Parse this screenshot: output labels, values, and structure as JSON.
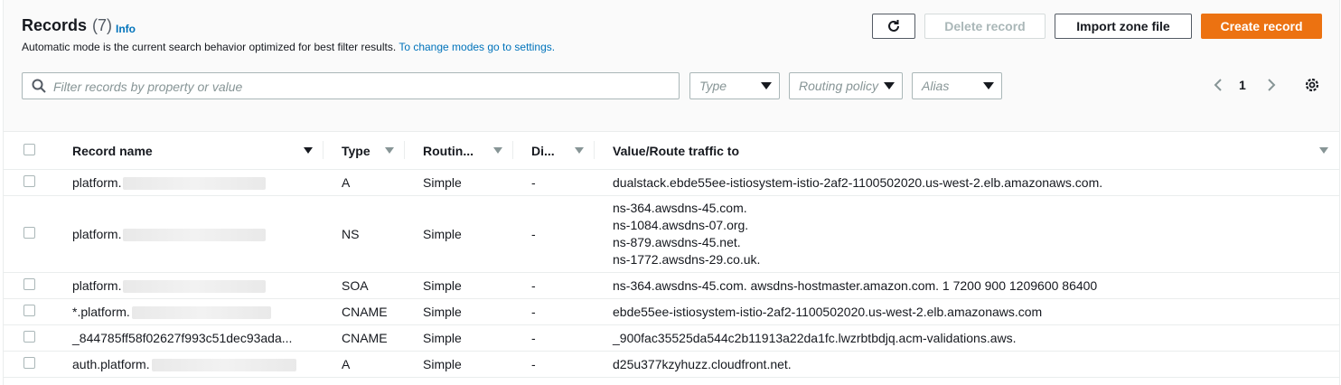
{
  "header": {
    "title": "Records",
    "count": "(7)",
    "info_link": "Info",
    "description": "Automatic mode is the current search behavior optimized for best filter results.",
    "description_link": "To change modes go to settings."
  },
  "toolbar": {
    "refresh_icon": "refresh-icon",
    "delete_label": "Delete record",
    "import_label": "Import zone file",
    "create_label": "Create record"
  },
  "filters": {
    "search_placeholder": "Filter records by property or value",
    "type_label": "Type",
    "routing_label": "Routing policy",
    "alias_label": "Alias"
  },
  "pagination": {
    "current_page": "1"
  },
  "table": {
    "columns": [
      "Record name",
      "Type",
      "Routin...",
      "Di...",
      "Value/Route traffic to"
    ],
    "rows": [
      {
        "name": "platform.",
        "type": "A",
        "routing": "Simple",
        "di": "-",
        "values": [
          "dualstack.ebde55ee-istiosystem-istio-2af2-1100502020.us-west-2.elb.amazonaws.com."
        ]
      },
      {
        "name": "platform.",
        "type": "NS",
        "routing": "Simple",
        "di": "-",
        "values": [
          "ns-364.awsdns-45.com.",
          "ns-1084.awsdns-07.org.",
          "ns-879.awsdns-45.net.",
          "ns-1772.awsdns-29.co.uk."
        ]
      },
      {
        "name": "platform.",
        "type": "SOA",
        "routing": "Simple",
        "di": "-",
        "values": [
          "ns-364.awsdns-45.com. awsdns-hostmaster.amazon.com. 1 7200 900 1209600 86400"
        ]
      },
      {
        "name": "*.platform.",
        "type": "CNAME",
        "routing": "Simple",
        "di": "-",
        "values": [
          "ebde55ee-istiosystem-istio-2af2-1100502020.us-west-2.elb.amazonaws.com"
        ]
      },
      {
        "name": "_844785ff58f02627f993c51dec93ada...",
        "type": "CNAME",
        "routing": "Simple",
        "di": "-",
        "values": [
          "_900fac35525da544c2b11913a22da1fc.lwzrbtbdjq.acm-validations.aws."
        ]
      },
      {
        "name": "auth.platform.",
        "type": "A",
        "routing": "Simple",
        "di": "-",
        "values": [
          "d25u377kzyhuzz.cloudfront.net."
        ]
      }
    ]
  },
  "colors": {
    "primary": "#ec7211",
    "link": "#0073bb"
  }
}
